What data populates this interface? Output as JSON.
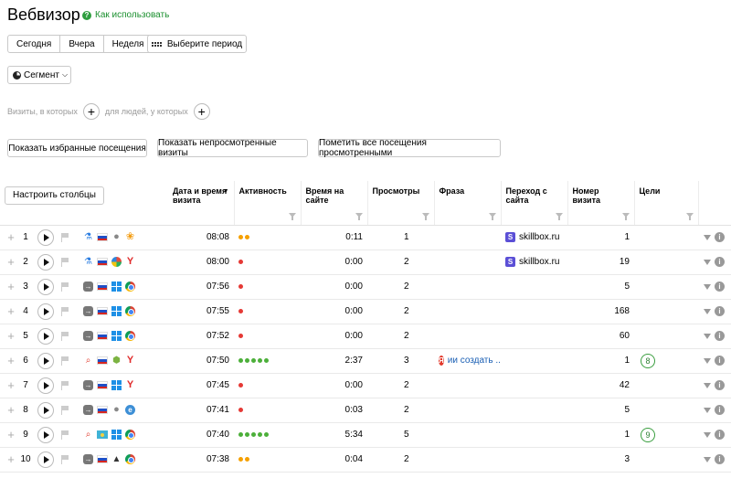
{
  "header": {
    "title": "Вебвизор",
    "howto_label": "Как использовать"
  },
  "period": {
    "options": [
      "Сегодня",
      "Вчера",
      "Неделя"
    ],
    "custom_label": "Выберите период"
  },
  "segment_label": "Сегмент",
  "filters": {
    "visits_label": "Визиты, в которых",
    "people_label": "для людей, у которых"
  },
  "actions": {
    "favorites": "Показать избранные посещения",
    "unviewed": "Показать непросмотренные визиты",
    "mark_all": "Пометить все посещения просмотренными"
  },
  "table": {
    "configure_label": "Настроить столбцы",
    "columns": {
      "datetime": "Дата и время визита",
      "activity": "Активность",
      "time_on_site": "Время на сайте",
      "views": "Просмотры",
      "phrase": "Фраза",
      "referrer": "Переход с сайта",
      "visit_no": "Номер визита",
      "goals": "Цели"
    },
    "sort_indicator": "▼",
    "colors": {
      "dot_red": "#e53935",
      "dot_orange": "#f5a000",
      "dot_green": "#4caf3a"
    },
    "rows": [
      {
        "n": "1",
        "source": "link",
        "os": "apple",
        "browser": "uc",
        "time": "08:08",
        "activity": "orange",
        "dots": 2,
        "duration": "0:11",
        "views": "1",
        "phrase": "",
        "referrer": "skillbox.ru",
        "visit_no": "1",
        "goal": ""
      },
      {
        "n": "2",
        "source": "link",
        "os": "xp",
        "browser": "yandex",
        "time": "08:00",
        "activity": "red",
        "dots": 1,
        "duration": "0:00",
        "views": "2",
        "phrase": "",
        "referrer": "skillbox.ru",
        "visit_no": "19",
        "goal": ""
      },
      {
        "n": "3",
        "source": "direct",
        "os": "windows",
        "browser": "chrome",
        "time": "07:56",
        "activity": "red",
        "dots": 1,
        "duration": "0:00",
        "views": "2",
        "phrase": "",
        "referrer": "",
        "visit_no": "5",
        "goal": ""
      },
      {
        "n": "4",
        "source": "direct",
        "os": "windows",
        "browser": "chrome",
        "time": "07:55",
        "activity": "red",
        "dots": 1,
        "duration": "0:00",
        "views": "2",
        "phrase": "",
        "referrer": "",
        "visit_no": "168",
        "goal": ""
      },
      {
        "n": "5",
        "source": "direct",
        "os": "windows",
        "browser": "chrome",
        "time": "07:52",
        "activity": "red",
        "dots": 1,
        "duration": "0:00",
        "views": "2",
        "phrase": "",
        "referrer": "",
        "visit_no": "60",
        "goal": ""
      },
      {
        "n": "6",
        "source": "search",
        "os": "android",
        "browser": "yandex",
        "time": "07:50",
        "activity": "green",
        "dots": 5,
        "duration": "2:37",
        "views": "3",
        "phrase": "ии создать ...",
        "referrer": "",
        "visit_no": "1",
        "goal": "8"
      },
      {
        "n": "7",
        "source": "direct",
        "os": "windows",
        "browser": "yandex",
        "time": "07:45",
        "activity": "red",
        "dots": 1,
        "duration": "0:00",
        "views": "2",
        "phrase": "",
        "referrer": "",
        "visit_no": "42",
        "goal": ""
      },
      {
        "n": "8",
        "source": "direct",
        "os": "apple",
        "browser": "ie",
        "time": "07:41",
        "activity": "red",
        "dots": 1,
        "duration": "0:03",
        "views": "2",
        "phrase": "",
        "referrer": "",
        "visit_no": "5",
        "goal": ""
      },
      {
        "n": "9",
        "source": "search",
        "flag": "kz",
        "os": "windows",
        "browser": "chrome",
        "time": "07:40",
        "activity": "green",
        "dots": 5,
        "duration": "5:34",
        "views": "5",
        "phrase": "",
        "referrer": "",
        "visit_no": "1",
        "goal": "9"
      },
      {
        "n": "10",
        "source": "direct",
        "os": "linux",
        "browser": "chrome",
        "time": "07:38",
        "activity": "orange",
        "dots": 2,
        "duration": "0:04",
        "views": "2",
        "phrase": "",
        "referrer": "",
        "visit_no": "3",
        "goal": ""
      }
    ]
  }
}
